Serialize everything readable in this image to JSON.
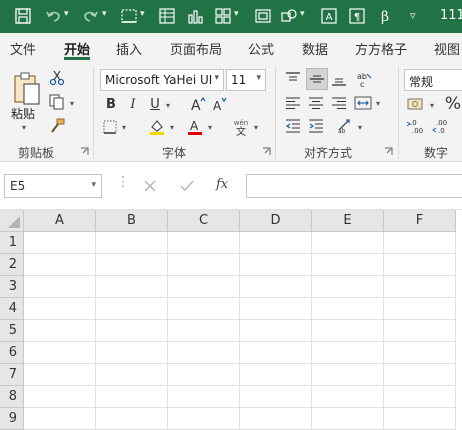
{
  "colors": {
    "brand_green": "#217346",
    "ribbon_bg": "#f3f3f3",
    "font_color_red": "#e00000",
    "highlight_yellow": "#ffd400"
  },
  "quick_access": {
    "title_fragment": "111",
    "icons": [
      "save-icon",
      "undo-icon",
      "redo-icon",
      "borders-icon",
      "table-format-icon",
      "chart-icon",
      "layout-icon",
      "shapes-icon",
      "text-box-icon",
      "symbol-icon",
      "customize-icon"
    ]
  },
  "tabs": [
    "文件",
    "开始",
    "插入",
    "页面布局",
    "公式",
    "数据",
    "方方格子",
    "视图"
  ],
  "active_tab": "开始",
  "ribbon": {
    "clipboard": {
      "paste_label": "粘贴",
      "group_label": "剪贴板"
    },
    "font": {
      "font_name": "Microsoft YaHei UI",
      "font_size": "11",
      "group_label": "字体",
      "bold": "B",
      "italic": "I",
      "underline": "U",
      "wen_label": "wén"
    },
    "alignment": {
      "group_label": "对齐方式"
    },
    "number": {
      "format": "常规",
      "group_label": "数字",
      "percent": "%"
    }
  },
  "formula_bar": {
    "name_box": "E5",
    "fx_label": "fx",
    "formula": ""
  },
  "grid": {
    "columns": [
      "A",
      "B",
      "C",
      "D",
      "E",
      "F"
    ],
    "rows": [
      "1",
      "2",
      "3",
      "4",
      "5",
      "6",
      "7",
      "8",
      "9"
    ]
  }
}
